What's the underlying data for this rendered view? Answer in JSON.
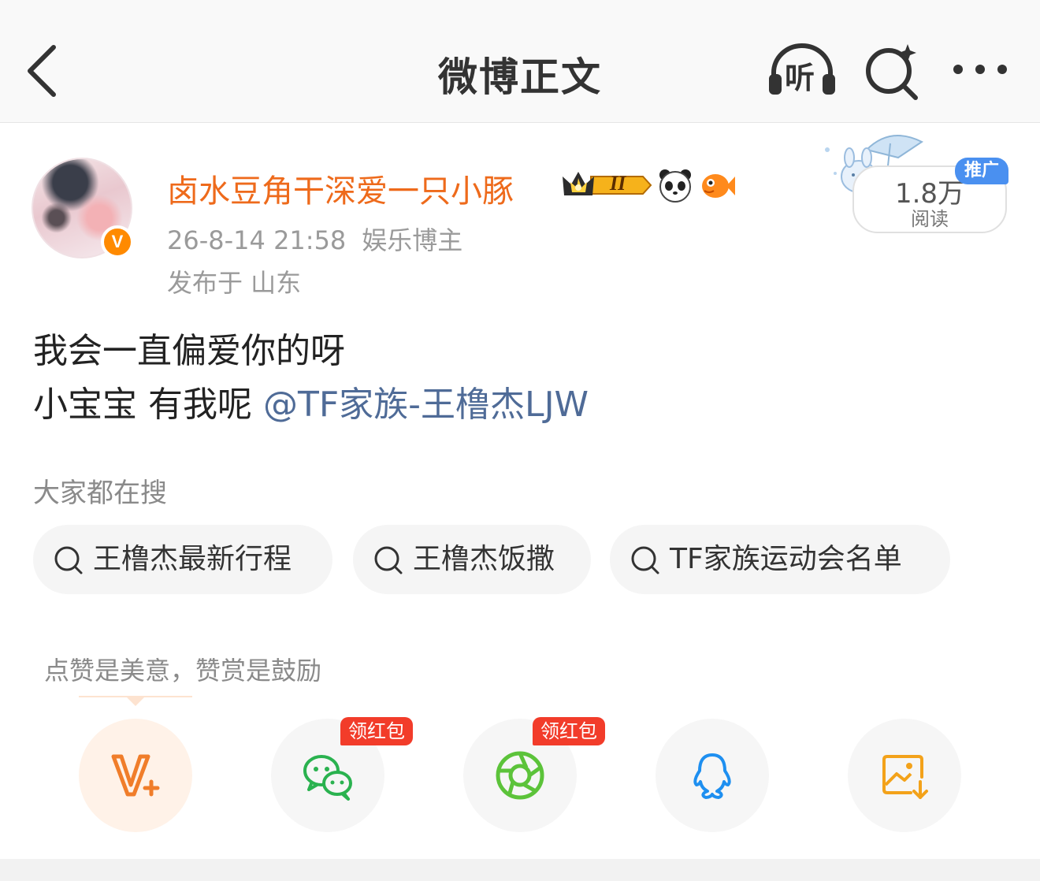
{
  "nav": {
    "title": "微博正文",
    "listen_label": "听"
  },
  "author": {
    "name": "卤水豆角干深爱一只小豚",
    "verified_mark": "V",
    "vip_level": "II",
    "timestamp": "26-8-14 21:58",
    "role": "娱乐博主",
    "location": "发布于 山东"
  },
  "promo": {
    "count": "1.8万",
    "label": "阅读",
    "tag": "推广"
  },
  "post": {
    "line1": "我会一直偏爱你的呀",
    "line2_text": "小宝宝 有我呢",
    "mention": "@TF家族-王橹杰LJW"
  },
  "search": {
    "heading": "大家都在搜",
    "chips": [
      {
        "label": "王橹杰最新行程"
      },
      {
        "label": "王橹杰饭撒"
      },
      {
        "label": "TF家族运动会名单"
      }
    ]
  },
  "reward": {
    "tip": "点赞是美意，赞赏是鼓励"
  },
  "share": {
    "redpack_label_1": "领红包",
    "redpack_label_2": "领红包",
    "icons": [
      "reward-v-icon",
      "wechat-icon",
      "moments-icon",
      "qq-icon",
      "save-image-icon"
    ]
  },
  "colors": {
    "username": "#ee6a1b",
    "mention": "#4f6b97",
    "verified": "#ff8a00",
    "promo_tag": "#4a90f0",
    "redpack": "#f23c2a",
    "wechat": "#2ab24f",
    "moments": "#5cc33a",
    "qq": "#1e8ff0",
    "save": "#f3a21a"
  }
}
